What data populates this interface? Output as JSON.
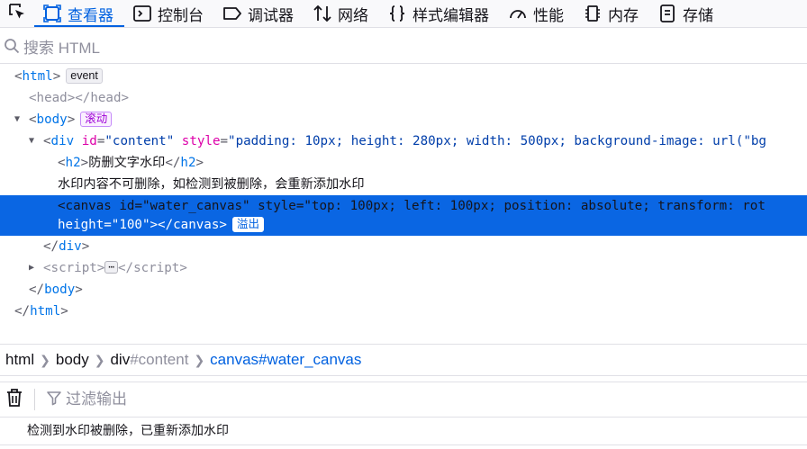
{
  "toolbar": {
    "tabs": [
      {
        "label": "查看器",
        "icon": "inspector-icon"
      },
      {
        "label": "控制台",
        "icon": "console-icon"
      },
      {
        "label": "调试器",
        "icon": "debugger-icon"
      },
      {
        "label": "网络",
        "icon": "network-icon"
      },
      {
        "label": "样式编辑器",
        "icon": "style-editor-icon"
      },
      {
        "label": "性能",
        "icon": "performance-icon"
      },
      {
        "label": "内存",
        "icon": "memory-icon"
      },
      {
        "label": "存储",
        "icon": "storage-icon"
      }
    ],
    "active_tab": "查看器"
  },
  "search": {
    "placeholder": "搜索 HTML"
  },
  "tree": {
    "html_tag": "html",
    "event_badge": "event",
    "head_tag": "head",
    "body_tag": "body",
    "scroll_badge": "滚动",
    "div": {
      "tag": "div",
      "id_attr": "id",
      "id_value": "\"content\"",
      "style_attr": "style",
      "style_value": "\"padding: 10px; height: 280px; width: 500px; background-image: url(\"bg"
    },
    "h2_tag": "h2",
    "h2_text": "防删文字水印",
    "text_node": "水印内容不可删除，如检测到被删除，会重新添加水印",
    "canvas": {
      "tag": "canvas",
      "id_attr": "id",
      "id_value": "\"water_canvas\"",
      "style_attr": "style",
      "style_value": "\"top: 100px; left: 100px; position: absolute; transform: rot",
      "height_attr": "height",
      "height_value": "\"100\"",
      "overflow_badge": "溢出"
    },
    "script_tag": "script",
    "ellipsis": "⋯"
  },
  "breadcrumbs": [
    {
      "tag": "html",
      "id": ""
    },
    {
      "tag": "body",
      "id": ""
    },
    {
      "tag": "div",
      "id": "#content"
    },
    {
      "tag": "canvas",
      "id": "#water_canvas"
    }
  ],
  "console": {
    "filter_placeholder": "过滤输出",
    "message": "检测到水印被删除，已重新添加水印"
  },
  "colors": {
    "accent": "#0061e0",
    "selection": "#0a66e3",
    "tag": "#0074e8",
    "attr_name": "#dd00a9",
    "attr_value": "#003eaa"
  }
}
